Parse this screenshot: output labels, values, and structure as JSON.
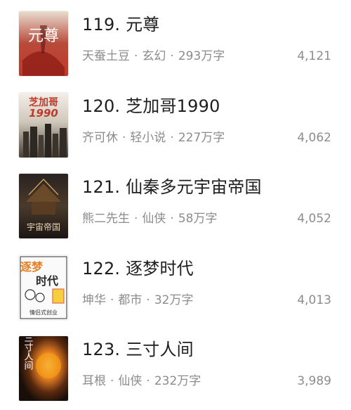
{
  "books": [
    {
      "title": "119. 元尊",
      "author": "天蚕土豆",
      "genre": "玄幻",
      "words": "293万字",
      "count": "4,121",
      "cover_text": "元尊"
    },
    {
      "title": "120. 芝加哥1990",
      "author": "齐可休",
      "genre": "轻小说",
      "words": "227万字",
      "count": "4,062",
      "cover_text": "芝加哥",
      "cover_text_2": "1990"
    },
    {
      "title": "121. 仙秦多元宇宙帝国",
      "author": "熊二先生",
      "genre": "仙侠",
      "words": "58万字",
      "count": "4,052",
      "cover_text": "宇宙帝国"
    },
    {
      "title": "122. 逐梦时代",
      "author": "坤华",
      "genre": "都市",
      "words": "32万字",
      "count": "4,013",
      "cover_text": "逐梦",
      "cover_text_2": "时代",
      "cover_text_3": "情侣式创业"
    },
    {
      "title": "123. 三寸人间",
      "author": "耳根",
      "genre": "仙侠",
      "words": "232万字",
      "count": "3,989",
      "cover_text": "三寸人间"
    }
  ],
  "separator": "·",
  "colors": {
    "title": "#1e1e1e",
    "meta": "#8c8c8c",
    "background": "#ffffff"
  }
}
